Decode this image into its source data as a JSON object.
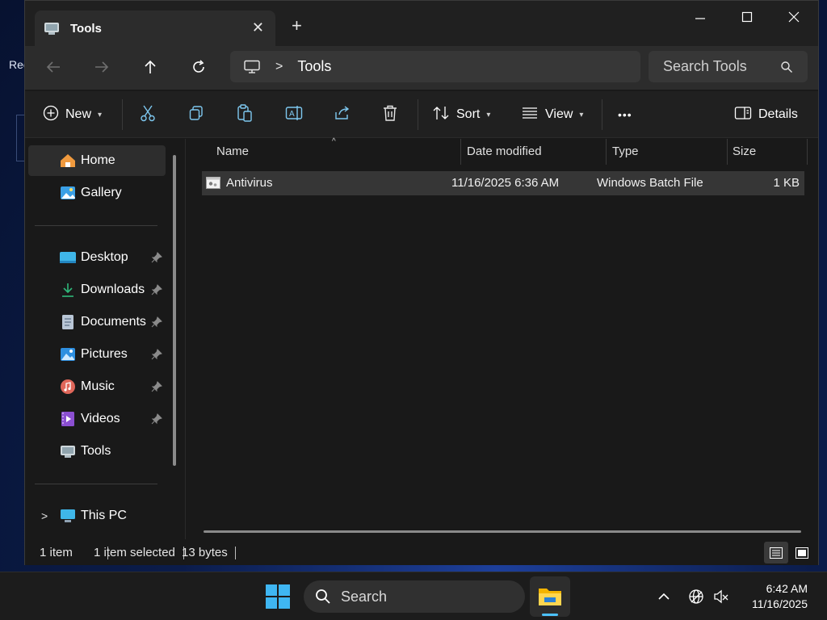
{
  "desktop": {
    "partial_label": "Rec"
  },
  "window": {
    "tab_title": "Tools",
    "new_tab_symbol": "+",
    "controls": {
      "minimize": "minimize-icon",
      "maximize": "maximize-icon",
      "close": "close-icon"
    }
  },
  "address_bar": {
    "breadcrumb_separator": ">",
    "breadcrumb": [
      "Tools"
    ],
    "search_placeholder": "Search Tools"
  },
  "toolbar": {
    "new_label": "New",
    "sort_label": "Sort",
    "view_label": "View",
    "more_label": "•••",
    "details_label": "Details"
  },
  "sidebar": {
    "items": [
      {
        "label": "Home",
        "icon": "home-icon",
        "active": true
      },
      {
        "label": "Gallery",
        "icon": "gallery-icon"
      },
      {
        "label": "Desktop",
        "icon": "desktop-folder-icon",
        "pinned": true
      },
      {
        "label": "Downloads",
        "icon": "downloads-folder-icon",
        "pinned": true
      },
      {
        "label": "Documents",
        "icon": "documents-folder-icon",
        "pinned": true
      },
      {
        "label": "Pictures",
        "icon": "pictures-folder-icon",
        "pinned": true
      },
      {
        "label": "Music",
        "icon": "music-folder-icon",
        "pinned": true
      },
      {
        "label": "Videos",
        "icon": "videos-folder-icon",
        "pinned": true
      },
      {
        "label": "Tools",
        "icon": "tools-folder-icon"
      },
      {
        "label": "This PC",
        "icon": "this-pc-icon"
      }
    ]
  },
  "file_list": {
    "columns": [
      "Name",
      "Date modified",
      "Type",
      "Size"
    ],
    "rows": [
      {
        "name": "Antivirus",
        "date_modified": "11/16/2025 6:36 AM",
        "type": "Windows Batch File",
        "size": "1 KB",
        "selected": true
      }
    ]
  },
  "status_bar": {
    "item_count": "1 item",
    "selection": "1 item selected",
    "size": "13 bytes"
  },
  "taskbar": {
    "search_label": "Search",
    "time": "6:42 AM",
    "date": "11/16/2025"
  },
  "colors": {
    "accent": "#4cc2ff",
    "window_bg": "#191919",
    "selected_row": "#363636"
  }
}
